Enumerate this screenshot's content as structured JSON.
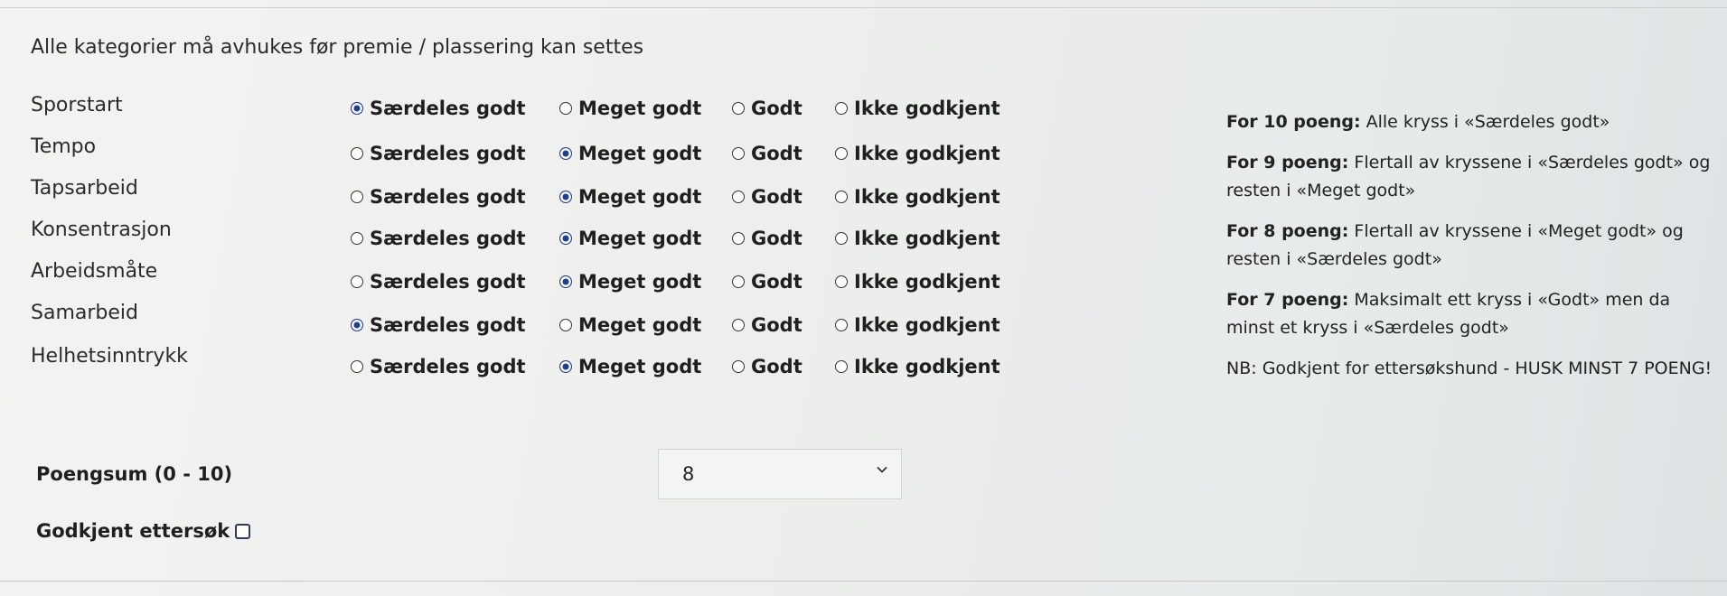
{
  "notice": "Alle kategorier må avhukes før premie / plassering kan settes",
  "options": [
    "Særdeles godt",
    "Meget godt",
    "Godt",
    "Ikke godkjent"
  ],
  "criteria": [
    {
      "label": "Sporstart",
      "selected": 0
    },
    {
      "label": "Tempo",
      "selected": 1
    },
    {
      "label": "Tapsarbeid",
      "selected": 1
    },
    {
      "label": "Konsentrasjon",
      "selected": 1
    },
    {
      "label": "Arbeidsmåte",
      "selected": 1
    },
    {
      "label": "Samarbeid",
      "selected": 0
    },
    {
      "label": "Helhetsinntrykk",
      "selected": 1
    }
  ],
  "rules": [
    {
      "bold": "For 10 poeng:",
      "text": " Alle kryss i «Særdeles godt»"
    },
    {
      "bold": "For 9 poeng:",
      "text": " Flertall av kryssene i «Særdeles godt» og resten i «Meget godt»"
    },
    {
      "bold": "For 8 poeng:",
      "text": " Flertall av kryssene i «Meget godt» og resten i «Særdeles godt»"
    },
    {
      "bold": "For 7 poeng:",
      "text": " Maksimalt ett kryss i «Godt» men da minst et kryss i «Særdeles godt»"
    },
    {
      "bold": "",
      "text": "NB: Godkjent for ettersøkshund - HUSK MINST 7 POENG!"
    }
  ],
  "score": {
    "label": "Poengsum (0 - 10)",
    "value": "8"
  },
  "approved": {
    "label": "Godkjent ettersøk",
    "checked": false
  },
  "colors": {
    "radio_selected": "#1c3f96",
    "text": "#1f1f1f"
  }
}
